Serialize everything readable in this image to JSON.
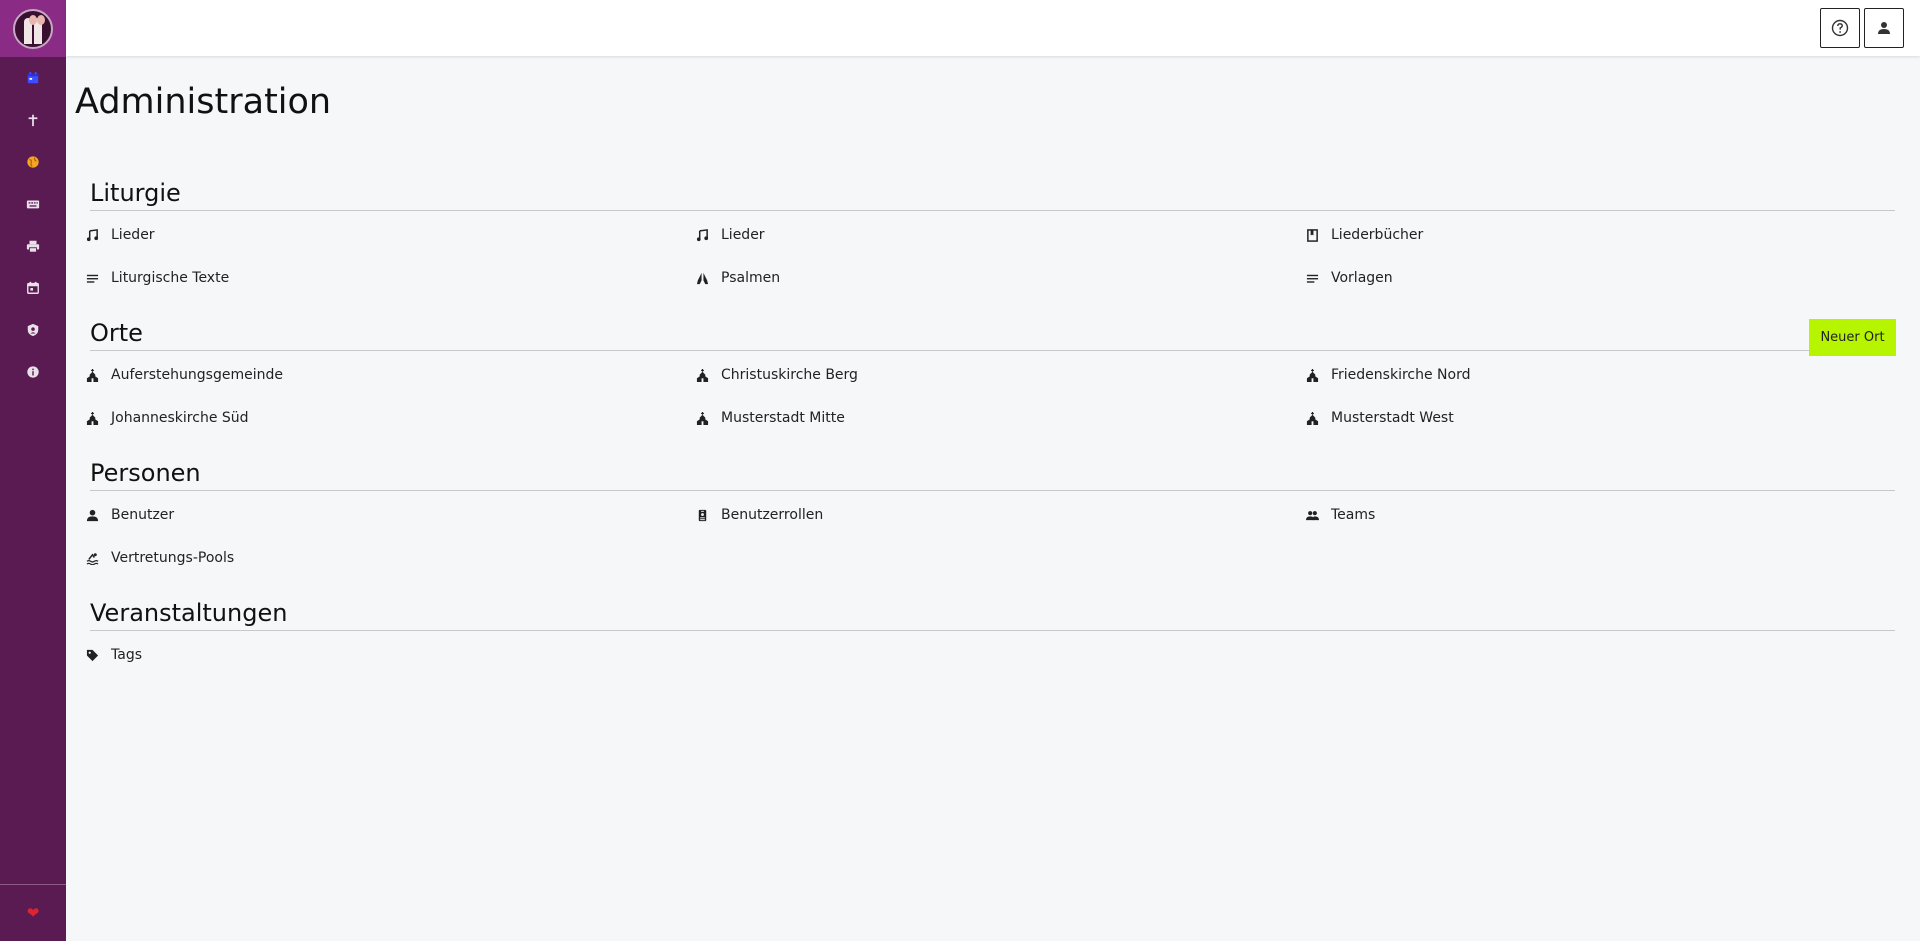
{
  "sidebar": {
    "nav": [
      {
        "icon": "calendar-icon",
        "color": "#3f4cff"
      },
      {
        "icon": "cross-icon",
        "color": "#e9e0ea"
      },
      {
        "icon": "globe-icon",
        "color": "#f5a623"
      },
      {
        "icon": "keyboard-icon",
        "color": "#e9e0ea"
      },
      {
        "icon": "printer-icon",
        "color": "#e9e0ea"
      },
      {
        "icon": "calendar-day-icon",
        "color": "#e9e0ea"
      },
      {
        "icon": "shield-user-icon",
        "color": "#e9e0ea"
      },
      {
        "icon": "info-icon",
        "color": "#e9e0ea"
      }
    ],
    "bottom_icon": "heart-icon",
    "bottom_glyph": "❤"
  },
  "topbar": {
    "help_icon": "help-icon",
    "user_icon": "user-icon"
  },
  "page_title": "Administration",
  "sections": {
    "liturgie": {
      "title": "Liturgie",
      "items": [
        {
          "label": "Lieder",
          "icon": "music-note-icon"
        },
        {
          "label": "Lieder",
          "icon": "music-note-icon"
        },
        {
          "label": "Liederbücher",
          "icon": "book-icon"
        },
        {
          "label": "Liturgische Texte",
          "icon": "text-lines-icon"
        },
        {
          "label": "Psalmen",
          "icon": "praying-hands-icon"
        },
        {
          "label": "Vorlagen",
          "icon": "text-lines-icon"
        }
      ]
    },
    "orte": {
      "title": "Orte",
      "new_button": "Neuer Ort",
      "items": [
        {
          "label": "Auferstehungsgemeinde",
          "icon": "church-icon"
        },
        {
          "label": "Christuskirche Berg",
          "icon": "church-icon"
        },
        {
          "label": "Friedenskirche Nord",
          "icon": "church-icon"
        },
        {
          "label": "Johanneskirche Süd",
          "icon": "church-icon"
        },
        {
          "label": "Musterstadt Mitte",
          "icon": "church-icon"
        },
        {
          "label": "Musterstadt West",
          "icon": "church-icon"
        }
      ]
    },
    "personen": {
      "title": "Personen",
      "items": [
        {
          "label": "Benutzer",
          "icon": "user-icon"
        },
        {
          "label": "Benutzerrollen",
          "icon": "id-badge-icon"
        },
        {
          "label": "Teams",
          "icon": "users-icon"
        },
        {
          "label": "Vertretungs-Pools",
          "icon": "swimmer-icon"
        }
      ]
    },
    "veranstaltungen": {
      "title": "Veranstaltungen",
      "items": [
        {
          "label": "Tags",
          "icon": "tag-icon"
        }
      ]
    }
  },
  "colors": {
    "sidebar_bg": "#5a1a52",
    "logo_bg": "#8a2b86",
    "accent_button": "#b7f400",
    "page_bg": "#f6f7f9"
  }
}
